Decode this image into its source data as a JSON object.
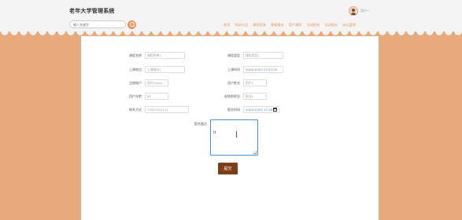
{
  "header": {
    "title": "老年大学管理系统",
    "search_placeholder": "输入关键字",
    "user_name": "用户一"
  },
  "nav": [
    "首页",
    "网站公告",
    "课程信息",
    "课程报名",
    "用户通知",
    "活动报名",
    "活动报名",
    "论坛管理"
  ],
  "form": {
    "course_name_label": "课程名称",
    "course_name_value": "课程名称1",
    "course_type_label": "课程类型",
    "course_type_value": "课程类型1",
    "location_label": "上课地点",
    "location_value": "上课地点1",
    "time_label": "上课时间",
    "time_value": "2024/12/02 17:57:25",
    "registered_label": "注册账户",
    "registered_value": "用户1xxxx",
    "user_name_label": "用户姓名",
    "user_name_value": "用户1",
    "age_label": "用户年龄",
    "age_value": "60",
    "position_label": "退休前职业",
    "position_value": "职业1",
    "phone_label": "联系方式",
    "phone_value": "13412341111",
    "signup_time_label": "报名时间",
    "signup_time_value": "2024/12/05 17:48",
    "remark_label": "报名备注",
    "remark_value": "tt",
    "submit_label": "提交"
  }
}
